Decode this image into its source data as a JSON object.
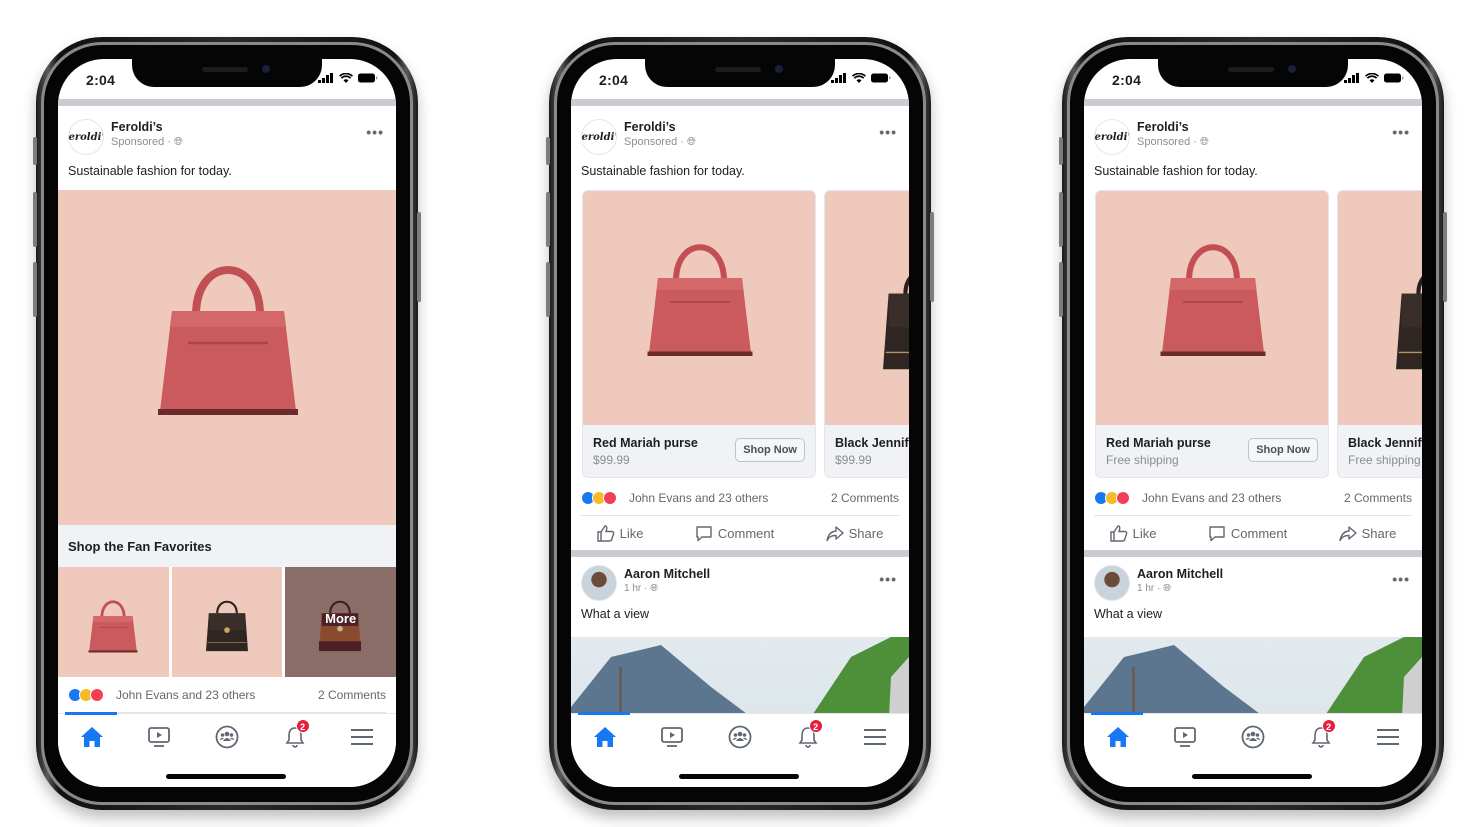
{
  "phones": [
    {
      "status": {
        "time": "2:04"
      },
      "post": {
        "page_name": "Feroldi’s",
        "sponsored": "Sponsored · ",
        "logo_text": "Feroldi's",
        "text": "Sustainable fashion for today.",
        "collection_title": "Shop the Fan Favorites",
        "more_label": "More",
        "reactions_text": "John Evans and 23 others",
        "comments_text": "2 Comments"
      },
      "tabbar": {
        "notification_count": "2"
      }
    },
    {
      "status": {
        "time": "2:04"
      },
      "post": {
        "page_name": "Feroldi’s",
        "sponsored": "Sponsored · ",
        "logo_text": "Feroldi's",
        "text": "Sustainable fashion for today.",
        "cards": [
          {
            "title": "Red Mariah purse",
            "subtitle": "$99.99",
            "button": "Shop Now"
          },
          {
            "title": "Black Jennifer",
            "subtitle": "$99.99"
          }
        ],
        "reactions_text": "John Evans and 23 others",
        "comments_text": "2 Comments",
        "actions": {
          "like": "Like",
          "comment": "Comment",
          "share": "Share"
        }
      },
      "post2": {
        "name": "Aaron Mitchell",
        "time": "1 hr · ",
        "text": "What a view"
      },
      "tabbar": {
        "notification_count": "2"
      }
    },
    {
      "status": {
        "time": "2:04"
      },
      "post": {
        "page_name": "Feroldi’s",
        "sponsored": "Sponsored · ",
        "logo_text": "Feroldi's",
        "text": "Sustainable fashion for today.",
        "cards": [
          {
            "title": "Red Mariah purse",
            "subtitle": "Free shipping",
            "button": "Shop Now"
          },
          {
            "title": "Black Jennifer",
            "subtitle": "Free shipping"
          }
        ],
        "reactions_text": "John Evans and 23 others",
        "comments_text": "2 Comments",
        "actions": {
          "like": "Like",
          "comment": "Comment",
          "share": "Share"
        }
      },
      "post2": {
        "name": "Aaron Mitchell",
        "time": "1 hr · ",
        "text": "What a view"
      },
      "tabbar": {
        "notification_count": "2"
      }
    }
  ],
  "colors": {
    "accent": "#1877f2",
    "badge": "#e41e3f",
    "product_bg": "#efc9bb",
    "red_bag": "#c9575b"
  }
}
